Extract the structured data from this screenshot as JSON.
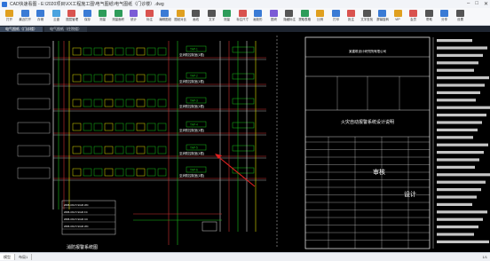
{
  "window": {
    "title": "CAD快速看图 - E:\\2020项目\\XX工程施工图\\电气图纸\\电气图纸（门诊楼）.dwg"
  },
  "toolbar": [
    {
      "label": "打开",
      "color": "#e0a020"
    },
    {
      "label": "最近打开",
      "color": "#3a7bd5"
    },
    {
      "label": "存储",
      "color": "#3a7bd5"
    },
    {
      "label": "云盘",
      "color": "#4aa3df"
    },
    {
      "label": "图层管理",
      "color": "#d9534f"
    },
    {
      "label": "保存",
      "color": "#3a7bd5"
    },
    {
      "label": "测量",
      "color": "#2e9c5a"
    },
    {
      "label": "测量面积",
      "color": "#2e9c5a"
    },
    {
      "label": "统计",
      "color": "#7b5bd6"
    },
    {
      "label": "标注",
      "color": "#d9534f"
    },
    {
      "label": "编辑图纸",
      "color": "#3a7bd5"
    },
    {
      "label": "图纸对比",
      "color": "#e0a020"
    },
    {
      "label": "画线",
      "color": "#555555"
    },
    {
      "label": "文字",
      "color": "#555555"
    },
    {
      "label": "测量",
      "color": "#2e9c5a"
    },
    {
      "label": "标注尺寸",
      "color": "#d9534f"
    },
    {
      "label": "画矩形",
      "color": "#3a7bd5"
    },
    {
      "label": "图块",
      "color": "#7b5bd6"
    },
    {
      "label": "隐藏标注",
      "color": "#555555"
    },
    {
      "label": "提取表格",
      "color": "#2e9c5a"
    },
    {
      "label": "比例",
      "color": "#e0a020"
    },
    {
      "label": "打印",
      "color": "#3a7bd5"
    },
    {
      "label": "批注",
      "color": "#d9534f"
    },
    {
      "label": "文字查找",
      "color": "#555555"
    },
    {
      "label": "屏幕旋转",
      "color": "#3a7bd5"
    },
    {
      "label": "VIP",
      "color": "#e0a020"
    },
    {
      "label": "会员",
      "color": "#d9534f"
    },
    {
      "label": "帮助",
      "color": "#555555"
    },
    {
      "label": "分享",
      "color": "#3a7bd5"
    },
    {
      "label": "设置",
      "color": "#555555"
    }
  ],
  "tabs": [
    {
      "label": "电气图纸（门诊楼）",
      "active": true
    },
    {
      "label": "电气图纸（住院楼）",
      "active": false
    }
  ],
  "drawing": {
    "tags": [
      "TAP-1",
      "TAP-2",
      "TAP-3",
      "TAP-4",
      "TAP-5",
      "TAP-6"
    ],
    "bus_label": "至消防控制室(1根)",
    "legend_rows": [
      "WFB-3X2.5 SC20 WC",
      "WFB-3X2.5 SC20 FC",
      "WFB-3X2.5 SC20 CC",
      "WFB-3X2.5 SC20 WC"
    ],
    "bottom_caption": "消防报警系统图",
    "block_title": "火灾自动报警系统设计说明",
    "company": "某建筑设计研究院有限公司",
    "stamps": [
      "审核",
      "设计"
    ]
  },
  "status": {
    "tabs": [
      "模型",
      "布局1"
    ],
    "pageinfo": "1/1"
  }
}
